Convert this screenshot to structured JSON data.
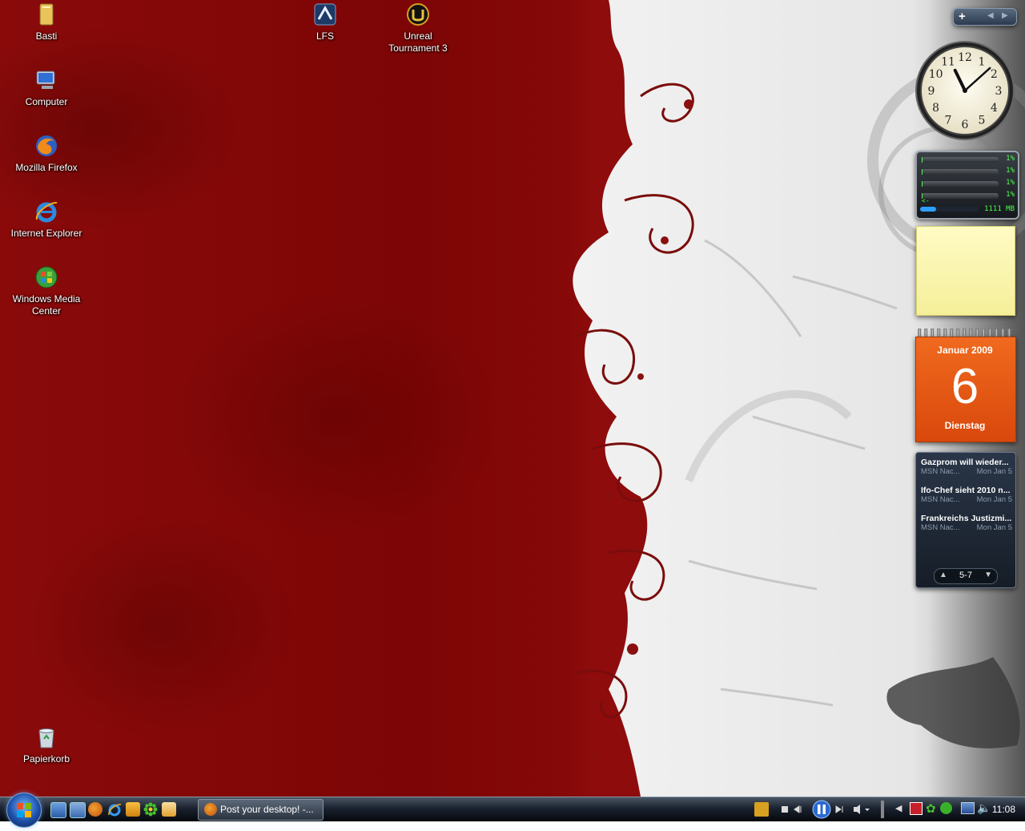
{
  "desktop": {
    "icons": [
      {
        "label": "Basti",
        "icon": "user-folder-icon"
      },
      {
        "label": "Computer",
        "icon": "computer-icon"
      },
      {
        "label": "Mozilla Firefox",
        "icon": "firefox-icon"
      },
      {
        "label": "Internet Explorer",
        "icon": "internet-explorer-icon"
      },
      {
        "label": "Windows Media Center",
        "icon": "media-center-icon"
      },
      {
        "label": "LFS",
        "icon": "lfs-game-icon"
      },
      {
        "label": "Unreal Tournament 3",
        "icon": "unreal-tournament-icon"
      },
      {
        "label": "Papierkorb",
        "icon": "recycle-bin-icon"
      }
    ]
  },
  "sidebar": {
    "add_label": "+",
    "clock": {
      "hour": 11,
      "minute": 8
    },
    "clock_numbers": [
      "12",
      "1",
      "2",
      "3",
      "4",
      "5",
      "6",
      "7",
      "8",
      "9",
      "10",
      "11"
    ],
    "cpu_meter": {
      "cores": [
        "1%",
        "1%",
        "1%",
        "1%"
      ],
      "core_levels": [
        0.01,
        0.01,
        0.01,
        0.01
      ],
      "arrow": "<-",
      "memory": "1111 MB",
      "memory_level": 0.27
    },
    "calendar": {
      "month": "Januar 2009",
      "day": "6",
      "weekday": "Dienstag"
    },
    "news": {
      "items": [
        {
          "title": "Gazprom will wieder...",
          "source": "MSN Nac...",
          "date": "Mon Jan 5"
        },
        {
          "title": "Ifo-Chef sieht 2010 n...",
          "source": "MSN Nac...",
          "date": "Mon Jan 5"
        },
        {
          "title": "Frankreichs Justizmi...",
          "source": "MSN Nac...",
          "date": "Mon Jan 5"
        }
      ],
      "page": "5-7"
    }
  },
  "taskbar": {
    "quick_launch": [
      "show-desktop-icon",
      "switch-windows-icon",
      "firefox-icon",
      "internet-explorer-icon",
      "media-player-icon",
      "icq-icon",
      "messenger-icon"
    ],
    "window_button": "Post your desktop! -...",
    "tray_time": "11:08",
    "colors": {
      "accent": "#1e4fa8",
      "wallpaper_red": "#8a0a0a"
    }
  }
}
